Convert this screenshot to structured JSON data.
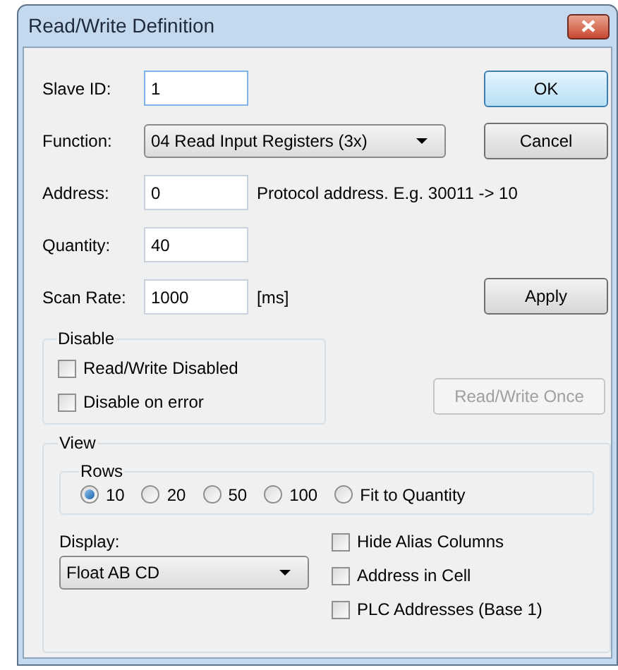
{
  "window": {
    "title": "Read/Write Definition"
  },
  "fields": [
    {
      "label": "Slave ID:",
      "kind": "text",
      "value": "1",
      "focused": true
    },
    {
      "label": "Function:",
      "kind": "select",
      "value": "04 Read Input Registers (3x)"
    },
    {
      "label": "Address:",
      "kind": "text",
      "value": "0",
      "note": "Protocol address. E.g. 30011 -> 10"
    },
    {
      "label": "Quantity:",
      "kind": "text",
      "value": "40"
    },
    {
      "label": "Scan Rate:",
      "kind": "text",
      "value": "1000",
      "note": "[ms]"
    }
  ],
  "buttons": [
    {
      "label": "OK",
      "default": true,
      "disabled": false
    },
    {
      "label": "Cancel",
      "default": false,
      "disabled": false
    },
    {
      "label": "Apply",
      "default": false,
      "disabled": false
    },
    {
      "label": "Read/Write Once",
      "default": false,
      "disabled": true
    }
  ],
  "disable_group": {
    "title": "Disable",
    "options": [
      {
        "label": "Read/Write Disabled",
        "checked": false
      },
      {
        "label": "Disable on error",
        "checked": false
      }
    ]
  },
  "view_group": {
    "title": "View",
    "rows": {
      "title": "Rows",
      "options": [
        {
          "label": "10",
          "selected": true
        },
        {
          "label": "20",
          "selected": false
        },
        {
          "label": "50",
          "selected": false
        },
        {
          "label": "100",
          "selected": false
        },
        {
          "label": "Fit to Quantity",
          "selected": false
        }
      ]
    },
    "display": {
      "label": "Display:",
      "value": "Float AB CD"
    },
    "options": [
      {
        "label": "Hide Alias Columns",
        "checked": false
      },
      {
        "label": "Address in Cell",
        "checked": false
      },
      {
        "label": "PLC Addresses (Base 1)",
        "checked": false
      }
    ]
  }
}
